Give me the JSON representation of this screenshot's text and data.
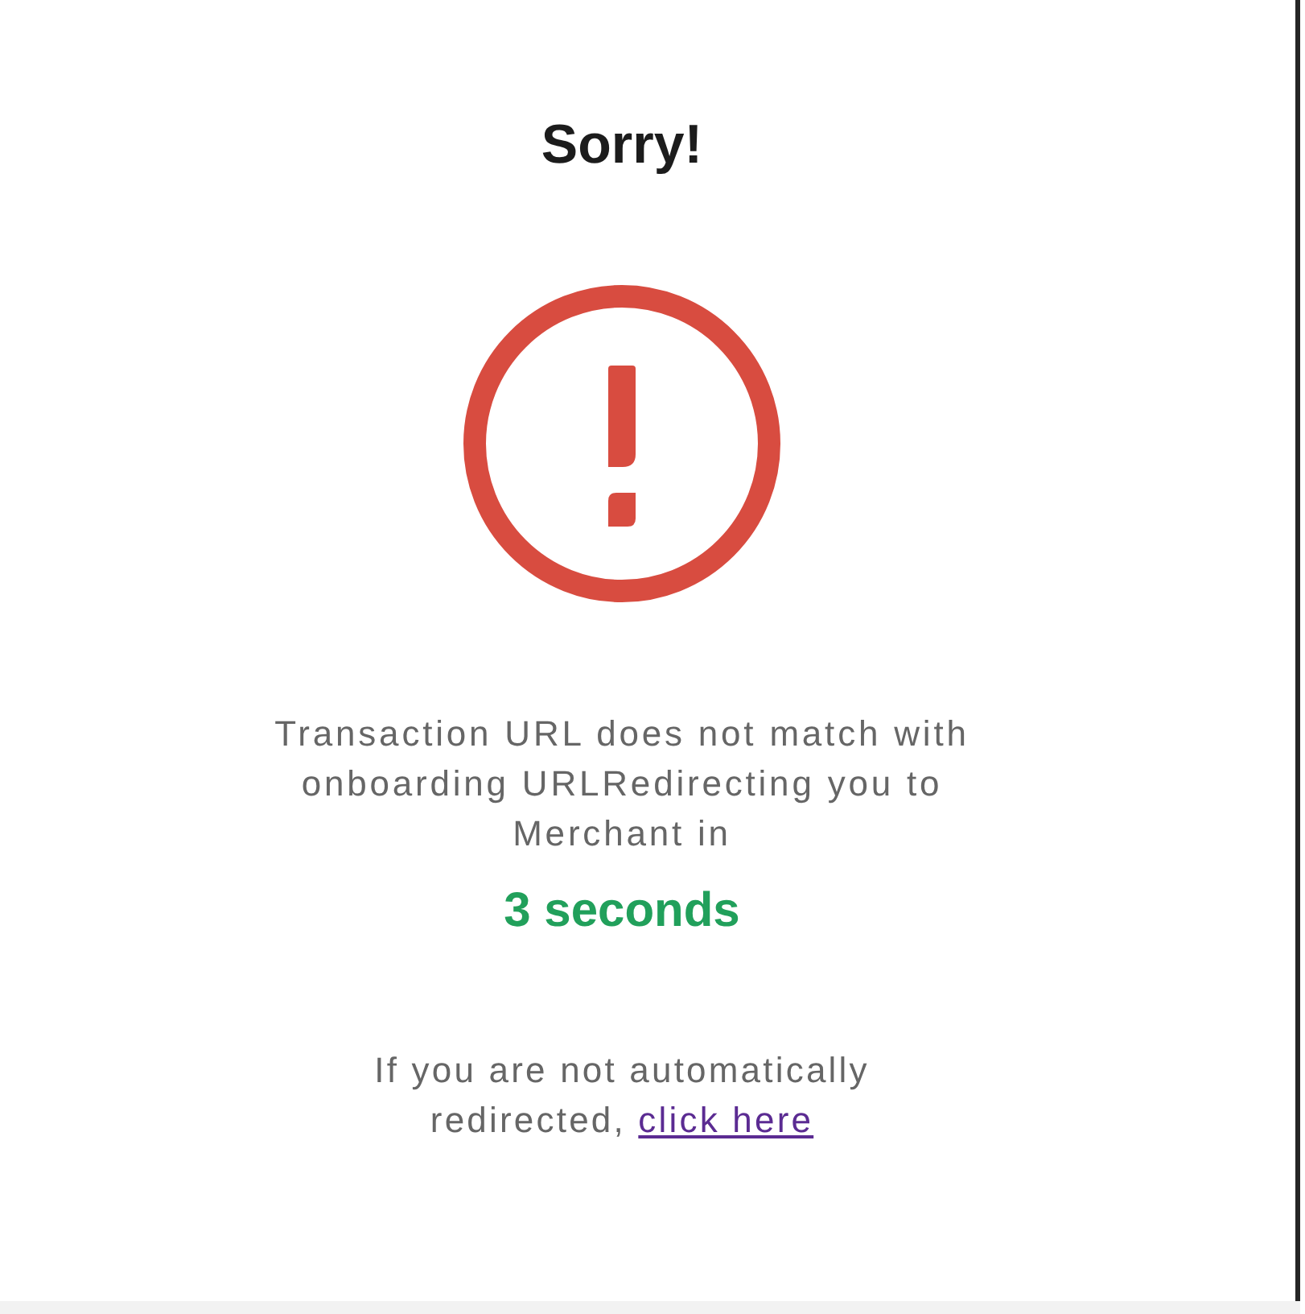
{
  "title": "Sorry!",
  "message": "Transaction URL does not match with onboarding URLRedirecting you to Merchant in",
  "countdown": "3 seconds",
  "fallback": {
    "text": "If you are not automatically redirected,",
    "link": "click here"
  }
}
